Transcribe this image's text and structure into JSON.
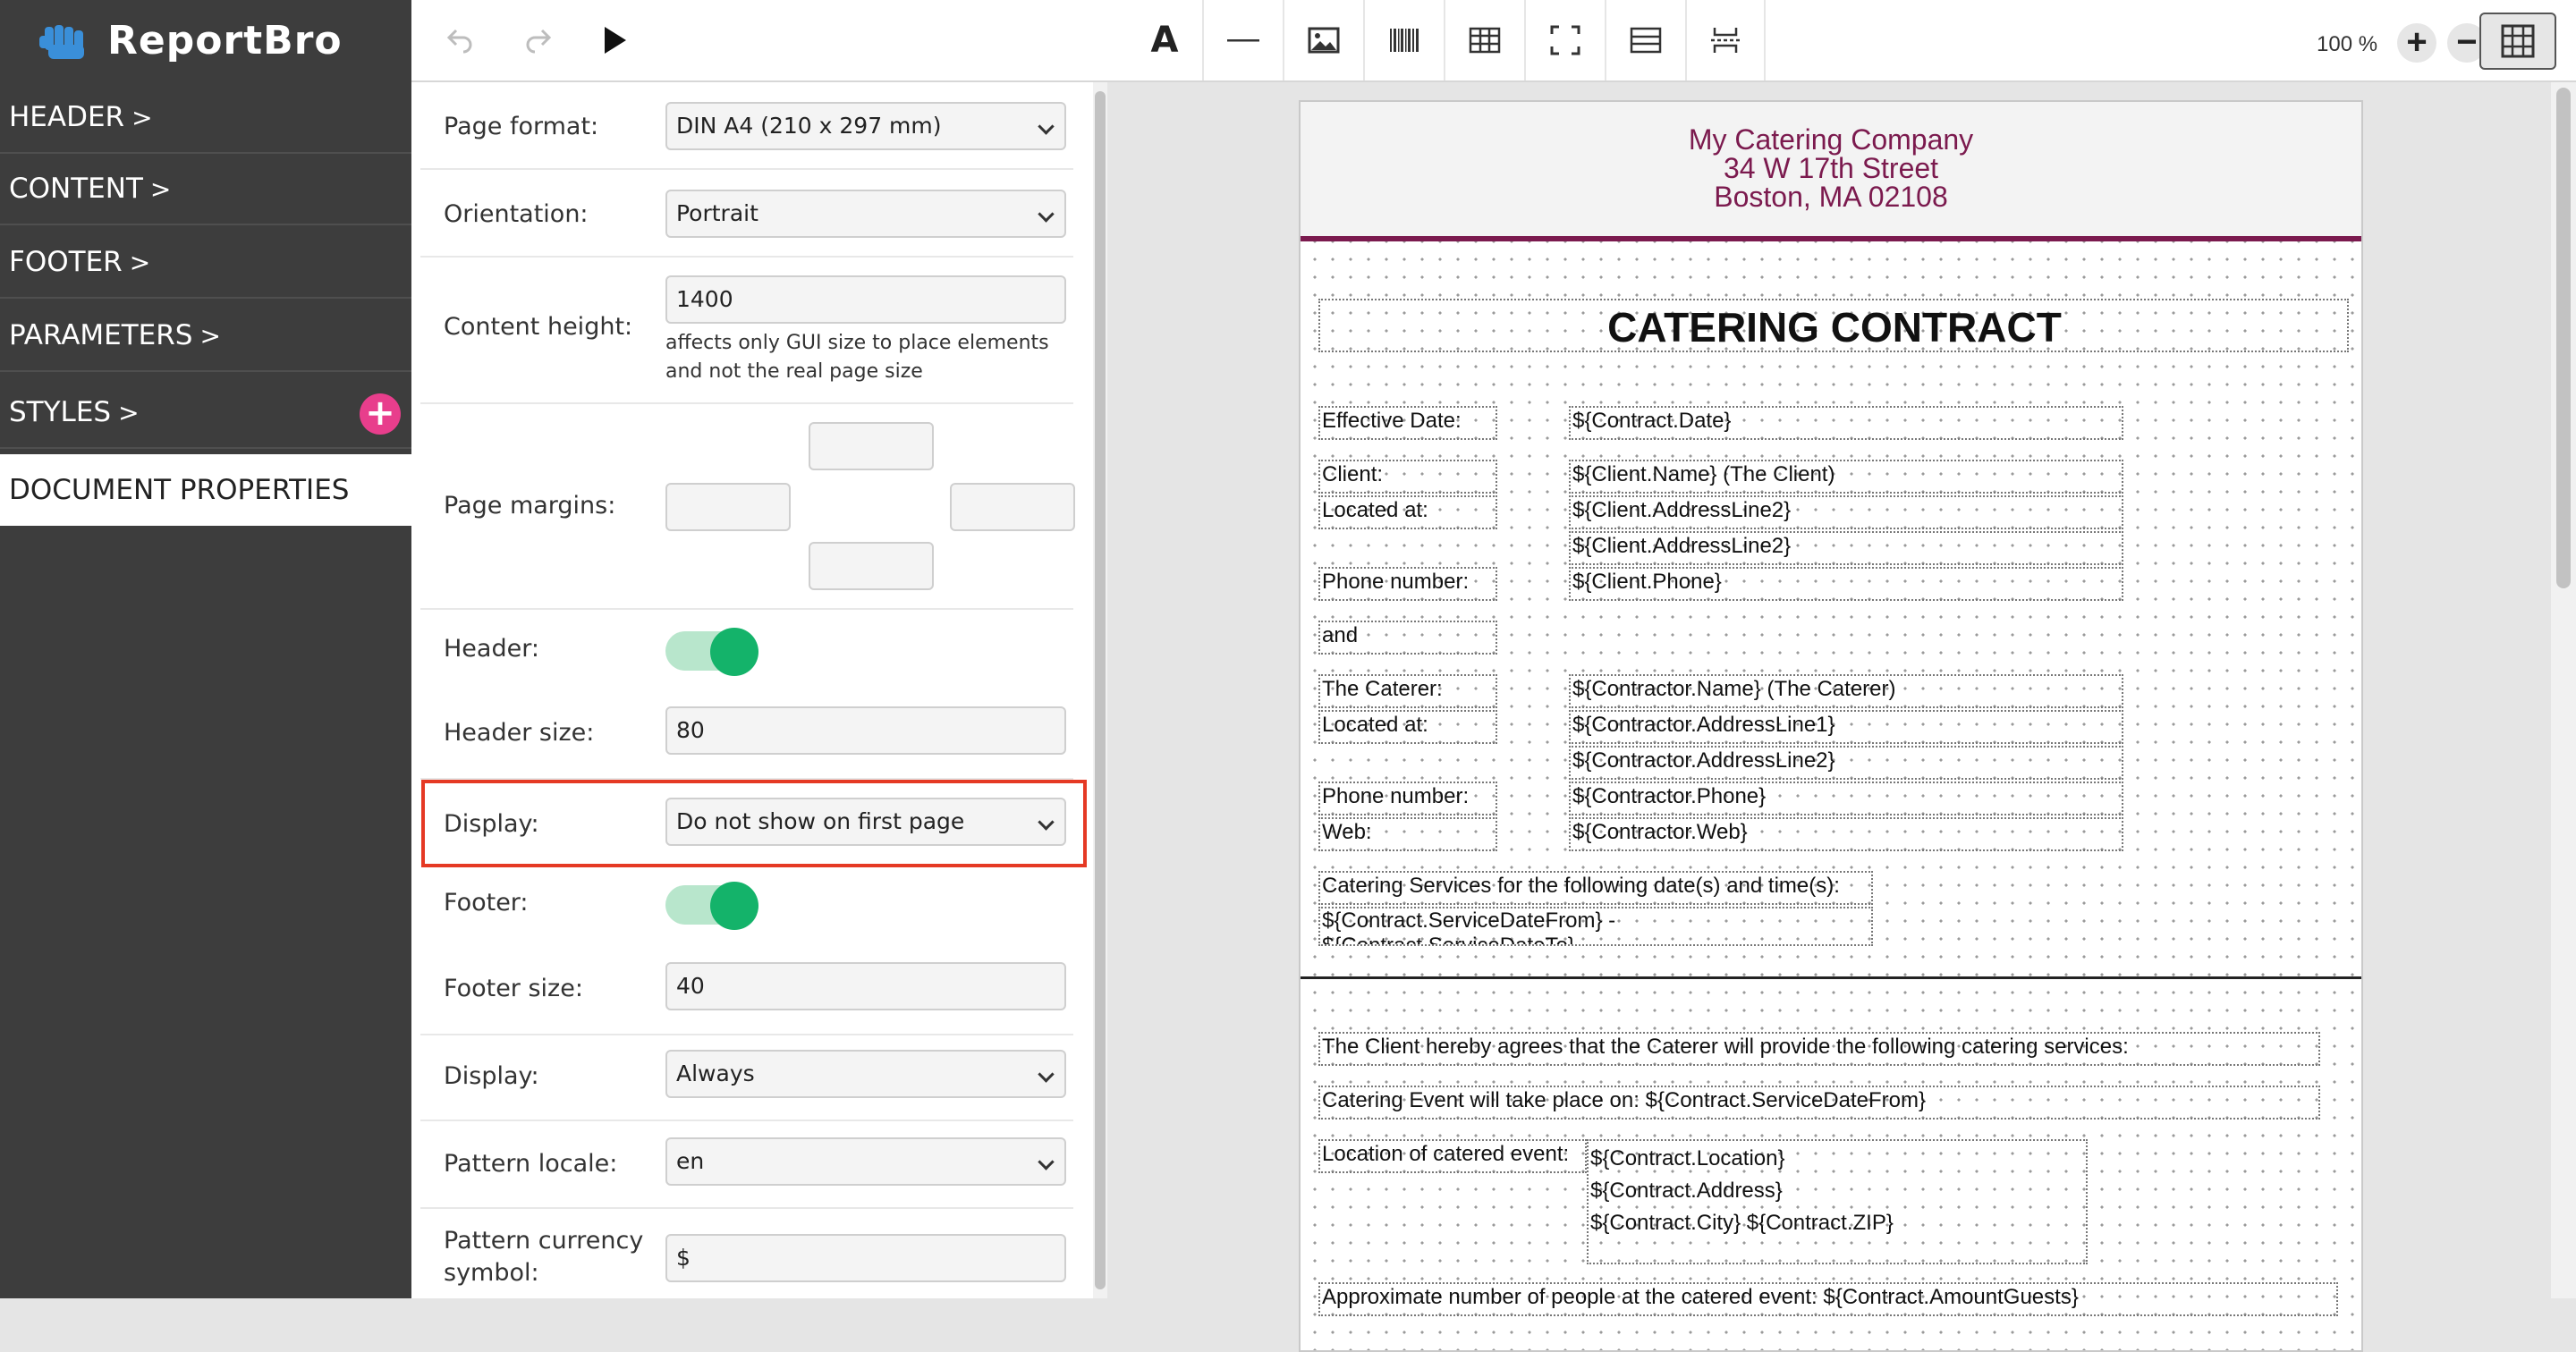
{
  "app": {
    "name": "ReportBro"
  },
  "sidebar": {
    "items": [
      {
        "label": "HEADER"
      },
      {
        "label": "CONTENT"
      },
      {
        "label": "FOOTER"
      },
      {
        "label": "PARAMETERS"
      },
      {
        "label": "STYLES"
      },
      {
        "label": "DOCUMENT PROPERTIES"
      }
    ],
    "chevron": ">",
    "styles_add": "+"
  },
  "toolbar": {
    "zoom": "100 %",
    "zoom_in": "+",
    "zoom_out": "−",
    "text_tool": "A",
    "icons": [
      "undo-icon",
      "redo-icon",
      "play-icon",
      "text-icon",
      "line-icon",
      "image-icon",
      "barcode-icon",
      "table-icon",
      "frame-icon",
      "section-icon",
      "page-break-icon",
      "grid-icon"
    ]
  },
  "properties": {
    "page_format": {
      "label": "Page format:",
      "value": "DIN A4 (210 x 297 mm)"
    },
    "orientation": {
      "label": "Orientation:",
      "value": "Portrait"
    },
    "content_height": {
      "label": "Content height:",
      "value": "1400",
      "hint": "affects only GUI size to place elements and not the real page size"
    },
    "page_margins": {
      "label": "Page margins:",
      "top": "",
      "left": "",
      "right": "",
      "bottom": ""
    },
    "header": {
      "label": "Header:",
      "enabled": true
    },
    "header_size": {
      "label": "Header size:",
      "value": "80"
    },
    "header_display": {
      "label": "Display:",
      "value": "Do not show on first page"
    },
    "footer": {
      "label": "Footer:",
      "enabled": true
    },
    "footer_size": {
      "label": "Footer size:",
      "value": "40"
    },
    "footer_display": {
      "label": "Display:",
      "value": "Always"
    },
    "pattern_locale": {
      "label": "Pattern locale:",
      "value": "en"
    },
    "pattern_currency": {
      "label": "Pattern currency symbol:",
      "value": "$"
    }
  },
  "document": {
    "company": [
      "My Catering Company",
      "34 W 17th Street",
      "Boston, MA 02108"
    ],
    "title": "CATERING CONTRACT",
    "labels": {
      "effective_date": "Effective Date:",
      "client": "Client:",
      "located_at": "Located at:",
      "phone": "Phone number:",
      "and": "and",
      "caterer": "The Caterer:",
      "located_at2": "Located at:",
      "phone2": "Phone number:",
      "web": "Web:"
    },
    "values": {
      "contract_date": "${Contract.Date}",
      "client_name": "${Client.Name} (The Client)",
      "client_addr1": "${Client.AddressLine2}",
      "client_addr2": "${Client.AddressLine2}",
      "client_phone": "${Client.Phone}",
      "contractor_name": "${Contractor.Name} (The Caterer)",
      "contractor_addr1": "${Contractor.AddressLine1}",
      "contractor_addr2": "${Contractor.AddressLine2}",
      "contractor_phone": "${Contractor.Phone}",
      "contractor_web": "${Contractor.Web}"
    },
    "services_heading": "Catering Services for the following date(s) and time(s):",
    "service_dates": "${Contract.ServiceDateFrom} - ${Contract.ServiceDateTo}",
    "agreement": "The Client hereby agrees that the Caterer will provide the following catering services:",
    "event_date": "Catering Event will take place on: ${Contract.ServiceDateFrom}",
    "location_label": "Location of catered event:",
    "location_lines": [
      "${Contract.Location}",
      "${Contract.Address}",
      "${Contract.City} ${Contract.ZIP}"
    ],
    "guests": "Approximate number of people at the catered event: ${Contract.AmountGuests}"
  },
  "colors": {
    "sidebar": "#3d3d3d",
    "accent_pink": "#e83e8c",
    "toggle_green": "#14b36a",
    "brand": "#7b1a4e",
    "highlight": "#e53924"
  }
}
